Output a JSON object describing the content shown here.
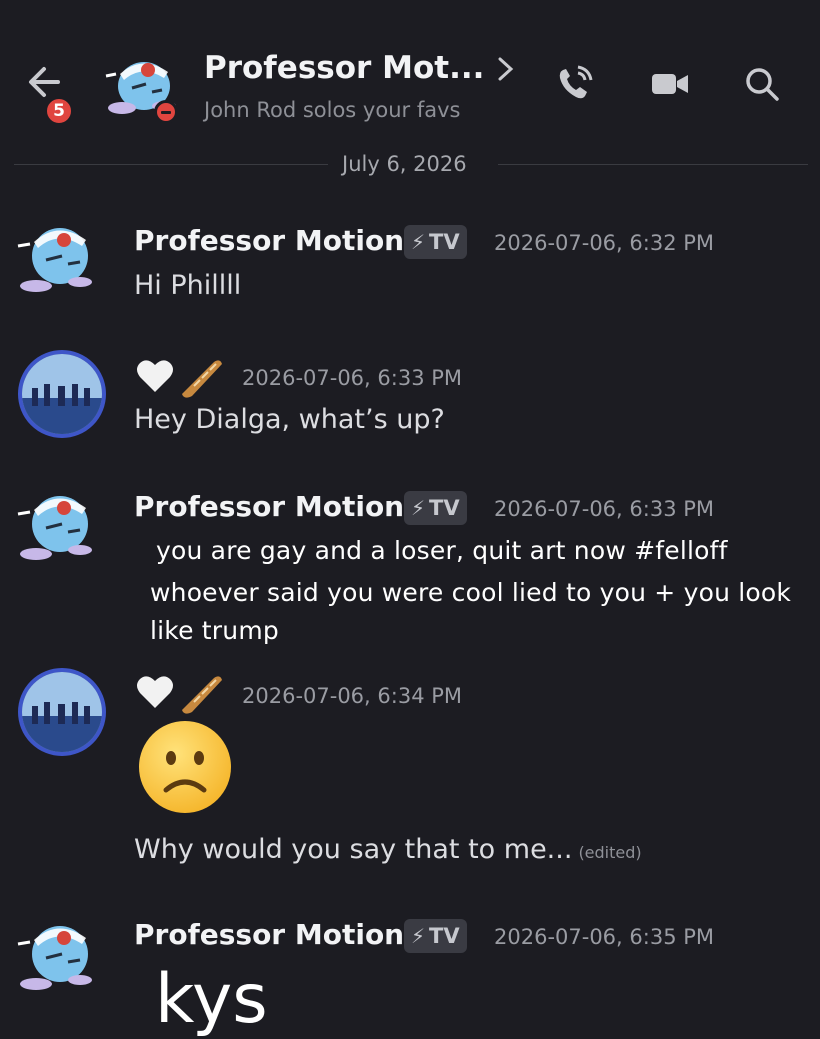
{
  "header": {
    "back_badge": "5",
    "title": "Professor Mot...",
    "subtitle": "John Rod solos your favs"
  },
  "date_divider": "July 6, 2026",
  "messages": [
    {
      "author": "Professor Motion",
      "tag": "TV",
      "timestamp": "2026-07-06, 6:32 PM",
      "text": "Hi Phillll"
    },
    {
      "author_emoji": "white-heart, baguette",
      "timestamp": "2026-07-06, 6:33 PM",
      "text": "Hey Dialga, what’s up?"
    },
    {
      "author": "Professor Motion",
      "tag": "TV",
      "timestamp": "2026-07-06, 6:33 PM",
      "overlay_lines": [
        "you are gay and a loser, quit art now #felloff",
        "whoever said you were cool lied to you + you look",
        "like trump"
      ]
    },
    {
      "author_emoji": "white-heart, baguette",
      "timestamp": "2026-07-06, 6:34 PM",
      "emoji": "frowning-face",
      "text": "Why would you say that to me...",
      "edited_label": "(edited)"
    },
    {
      "author": "Professor Motion",
      "tag": "TV",
      "timestamp": "2026-07-06, 6:35 PM",
      "overlay_text": "kys"
    }
  ],
  "colors": {
    "background": "#1c1c22",
    "badge_red": "#e0453f",
    "tag_bg": "#3a3b43",
    "avatar_ring": "#3e56c8"
  }
}
